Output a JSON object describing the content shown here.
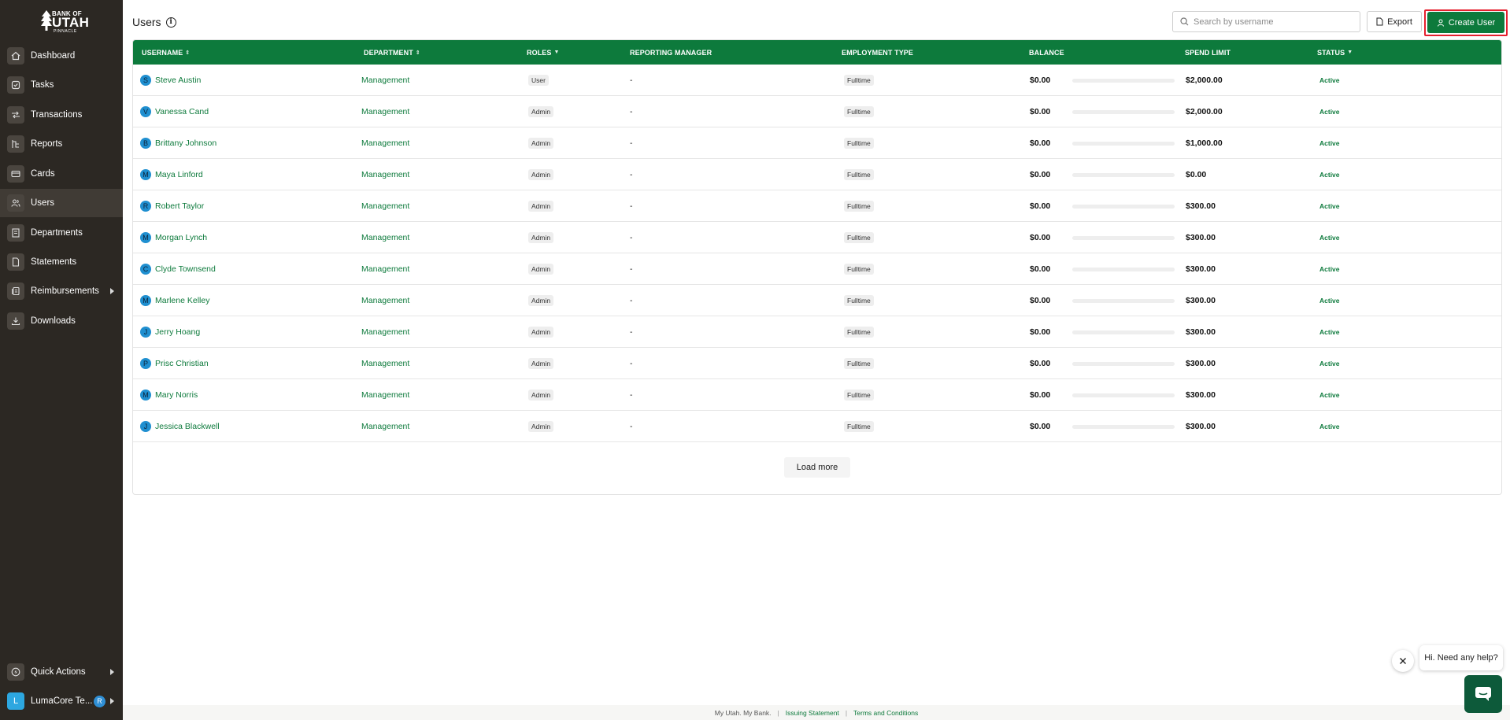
{
  "brand": {
    "line1": "BANK OF",
    "line2": "UTAH",
    "line3": "PINNACLE"
  },
  "sidebar": {
    "items": [
      {
        "label": "Dashboard",
        "icon": "home-icon"
      },
      {
        "label": "Tasks",
        "icon": "check-circle-icon"
      },
      {
        "label": "Transactions",
        "icon": "transfer-icon"
      },
      {
        "label": "Reports",
        "icon": "report-icon"
      },
      {
        "label": "Cards",
        "icon": "card-icon"
      },
      {
        "label": "Users",
        "icon": "users-icon"
      },
      {
        "label": "Departments",
        "icon": "building-icon"
      },
      {
        "label": "Statements",
        "icon": "document-icon"
      },
      {
        "label": "Reimbursements",
        "icon": "receipt-icon"
      },
      {
        "label": "Downloads",
        "icon": "download-icon"
      }
    ],
    "active": "Users",
    "quick_actions": "Quick Actions",
    "workspace": {
      "initial": "L",
      "name": "LumaCore Te...",
      "badge": "R"
    }
  },
  "header": {
    "title": "Users",
    "search_placeholder": "Search by username",
    "export_label": "Export",
    "create_label": "Create User"
  },
  "table": {
    "columns": [
      "USERNAME",
      "DEPARTMENT",
      "ROLES",
      "REPORTING MANAGER",
      "EMPLOYMENT TYPE",
      "BALANCE",
      "SPEND LIMIT",
      "STATUS"
    ],
    "rows": [
      {
        "initial": "S",
        "name": "Steve Austin",
        "department": "Management",
        "role": "User",
        "manager": "-",
        "employment": "Fulltime",
        "balance": "$0.00",
        "spend_used": 0,
        "spend_limit": "$2,000.00",
        "status": "Active"
      },
      {
        "initial": "V",
        "name": "Vanessa Cand",
        "department": "Management",
        "role": "Admin",
        "manager": "-",
        "employment": "Fulltime",
        "balance": "$0.00",
        "spend_used": 0,
        "spend_limit": "$2,000.00",
        "status": "Active"
      },
      {
        "initial": "B",
        "name": "Brittany Johnson",
        "department": "Management",
        "role": "Admin",
        "manager": "-",
        "employment": "Fulltime",
        "balance": "$0.00",
        "spend_used": 0,
        "spend_limit": "$1,000.00",
        "status": "Active"
      },
      {
        "initial": "M",
        "name": "Maya Linford",
        "department": "Management",
        "role": "Admin",
        "manager": "-",
        "employment": "Fulltime",
        "balance": "$0.00",
        "spend_used": 0,
        "spend_limit": "$0.00",
        "status": "Active"
      },
      {
        "initial": "R",
        "name": "Robert Taylor",
        "department": "Management",
        "role": "Admin",
        "manager": "-",
        "employment": "Fulltime",
        "balance": "$0.00",
        "spend_used": 0,
        "spend_limit": "$300.00",
        "status": "Active"
      },
      {
        "initial": "M",
        "name": "Morgan Lynch",
        "department": "Management",
        "role": "Admin",
        "manager": "-",
        "employment": "Fulltime",
        "balance": "$0.00",
        "spend_used": 0,
        "spend_limit": "$300.00",
        "status": "Active"
      },
      {
        "initial": "C",
        "name": "Clyde Townsend",
        "department": "Management",
        "role": "Admin",
        "manager": "-",
        "employment": "Fulltime",
        "balance": "$0.00",
        "spend_used": 0,
        "spend_limit": "$300.00",
        "status": "Active"
      },
      {
        "initial": "M",
        "name": "Marlene Kelley",
        "department": "Management",
        "role": "Admin",
        "manager": "-",
        "employment": "Fulltime",
        "balance": "$0.00",
        "spend_used": 0,
        "spend_limit": "$300.00",
        "status": "Active"
      },
      {
        "initial": "J",
        "name": "Jerry Hoang",
        "department": "Management",
        "role": "Admin",
        "manager": "-",
        "employment": "Fulltime",
        "balance": "$0.00",
        "spend_used": 0,
        "spend_limit": "$300.00",
        "status": "Active"
      },
      {
        "initial": "P",
        "name": "Prisc Christian",
        "department": "Management",
        "role": "Admin",
        "manager": "-",
        "employment": "Fulltime",
        "balance": "$0.00",
        "spend_used": 0,
        "spend_limit": "$300.00",
        "status": "Active"
      },
      {
        "initial": "M",
        "name": "Mary Norris",
        "department": "Management",
        "role": "Admin",
        "manager": "-",
        "employment": "Fulltime",
        "balance": "$0.00",
        "spend_used": 0,
        "spend_limit": "$300.00",
        "status": "Active"
      },
      {
        "initial": "J",
        "name": "Jessica Blackwell",
        "department": "Management",
        "role": "Admin",
        "manager": "-",
        "employment": "Fulltime",
        "balance": "$0.00",
        "spend_used": 0,
        "spend_limit": "$300.00",
        "status": "Active"
      }
    ],
    "load_more": "Load more"
  },
  "footer": {
    "tagline": "My Utah. My Bank.",
    "issuing": "Issuing Statement",
    "terms": "Terms and Conditions"
  },
  "chat": {
    "greeting": "Hi. Need any help?"
  },
  "colors": {
    "brand_green": "#0d7a3c",
    "sidebar_bg": "#2c2823",
    "highlight_red": "#e5202e",
    "avatar_blue": "#1f8fd0"
  }
}
